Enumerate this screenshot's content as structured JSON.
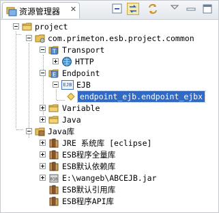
{
  "view": {
    "title": "资源管理器",
    "close_symbol": "✕"
  },
  "toolbar": {
    "icons": [
      "collapse-all-icon",
      "link-with-editor-icon",
      "sync-icon",
      "view-menu-icon"
    ]
  },
  "tree": {
    "project": "project",
    "package": "com.primeton.esb.project.common",
    "transport": "Transport",
    "http": "HTTP",
    "endpoint": "Endpoint",
    "ejb": "EJB",
    "ejb_badge": "EJB",
    "endpoint_ejbx": "endpoint_ejb.endpoint_ejbx",
    "variable": "Variable",
    "java": "Java",
    "java_lib": "Java库",
    "jre": "JRE 系统库 [eclipse]",
    "esb_all": "ESB程序全量库",
    "esb_default_dep": "ESB默认依赖库",
    "jar": "E:\\wangeb\\ABCEJB.jar",
    "esb_default_ref": "ESB默认引用库",
    "esb_api": "ESB程序API库"
  },
  "colors": {
    "selection": "#316ac5",
    "folder": "#e8c15a",
    "module_blue": "#3a6fc4"
  }
}
